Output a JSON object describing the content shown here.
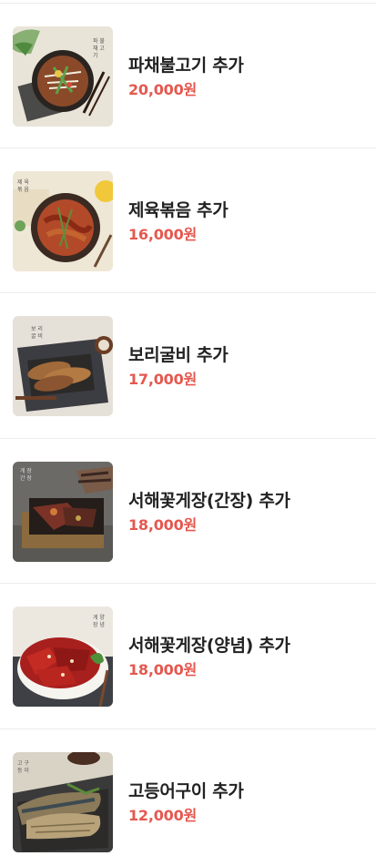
{
  "menu": {
    "items": [
      {
        "name": "파채불고기 추가",
        "price": "20,000원",
        "image": "bulgogi-dish-image"
      },
      {
        "name": "제육볶음 추가",
        "price": "16,000원",
        "image": "jeyuk-bokkeum-dish-image"
      },
      {
        "name": "보리굴비 추가",
        "price": "17,000원",
        "image": "boriguilbi-dish-image"
      },
      {
        "name": "서해꽃게장(간장) 추가",
        "price": "18,000원",
        "image": "soy-crab-dish-image"
      },
      {
        "name": "서해꽃게장(양념) 추가",
        "price": "18,000원",
        "image": "spicy-crab-dish-image"
      },
      {
        "name": "고등어구이 추가",
        "price": "12,000원",
        "image": "grilled-mackerel-dish-image"
      }
    ]
  }
}
